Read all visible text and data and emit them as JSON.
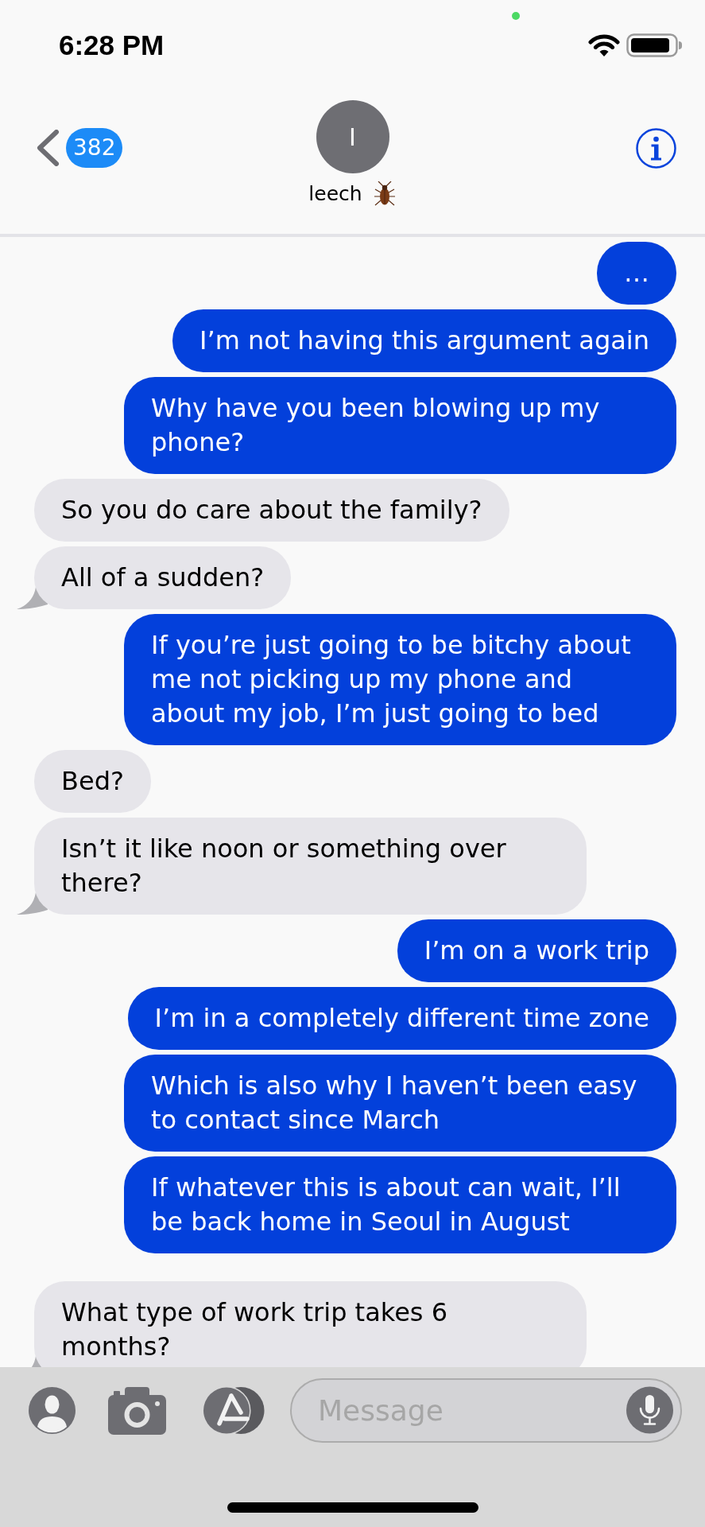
{
  "status_bar": {
    "time": "6:28 PM"
  },
  "header": {
    "unread_count": "382",
    "avatar_initial": "I",
    "contact_name": "leech"
  },
  "messages": [
    {
      "kind": "sent",
      "text": "…",
      "tail": false
    },
    {
      "kind": "sent",
      "text": "I’m not having this argument again",
      "tail": false
    },
    {
      "kind": "sent",
      "text": "Why have you been blowing up my phone?",
      "tail": false
    },
    {
      "kind": "received",
      "text": "So you do care about the family?",
      "tail": false
    },
    {
      "kind": "received",
      "text": "All of a sudden?",
      "tail": true
    },
    {
      "kind": "sent",
      "text": "If you’re just going to be bitchy about me not picking up my phone and about my job, I’m just going to bed",
      "tail": false
    },
    {
      "kind": "received",
      "text": "Bed?",
      "tail": false
    },
    {
      "kind": "received",
      "text": "Isn’t it like noon or something over there?",
      "tail": true
    },
    {
      "kind": "sent",
      "text": "I’m on a work trip",
      "tail": false
    },
    {
      "kind": "sent",
      "text": "I’m in a completely different time zone",
      "tail": false
    },
    {
      "kind": "sent",
      "text": "Which is also why I haven’t been easy to contact since March",
      "tail": false
    },
    {
      "kind": "sent",
      "text": "If whatever this is about can wait, I’ll be back home in Seoul in August",
      "tail": false
    },
    {
      "kind": "received",
      "text": "What type of work trip takes 6 months?",
      "tail": true
    }
  ],
  "composer": {
    "placeholder": "Message"
  }
}
